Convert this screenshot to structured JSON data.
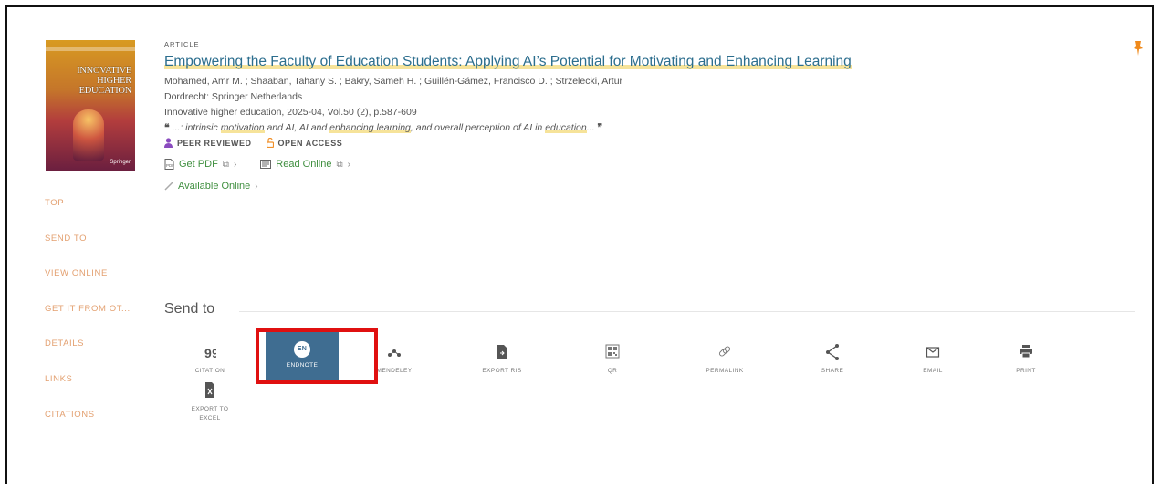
{
  "article": {
    "type": "ARTICLE",
    "title": "Empowering the Faculty of Education Students: Applying AI’s Potential for Motivating and Enhancing Learning",
    "authors": "Mohamed, Amr M. ; Shaaban, Tahany S. ; Bakry, Sameh H. ; Guillén-Gámez, Francisco D. ; Strzelecki, Artur",
    "publisher": "Dordrecht: Springer Netherlands",
    "source": "Innovative higher education, 2025-04, Vol.50 (2), p.587-609",
    "snippet": {
      "open_quote": "❝",
      "close_quote": "❞",
      "parts": [
        "...: intrinsic ",
        "motivation",
        " and AI, AI and ",
        "enhancing learning",
        ", and overall perception of AI in ",
        "education",
        "..."
      ]
    },
    "badges": {
      "peer_reviewed": "PEER REVIEWED",
      "open_access": "OPEN ACCESS"
    },
    "cover": {
      "title": "INNOVATIVE HIGHER EDUCATION",
      "publisher": "Springer"
    }
  },
  "links": {
    "get_pdf": "Get PDF",
    "read_online": "Read Online",
    "available_online": "Available Online"
  },
  "nav": {
    "items": [
      "TOP",
      "SEND TO",
      "VIEW ONLINE",
      "GET IT FROM OT...",
      "DETAILS",
      "LINKS",
      "CITATIONS"
    ]
  },
  "send_to": {
    "title": "Send to",
    "actions": [
      {
        "label": "CITATION",
        "icon": "quote-icon"
      },
      {
        "label": "ENDNOTE",
        "icon": "endnote-icon",
        "icon_text": "EN",
        "selected": true
      },
      {
        "label": "MENDELEY",
        "icon": "mendeley-icon"
      },
      {
        "label": "EXPORT RIS",
        "icon": "export-file-icon"
      },
      {
        "label": "QR",
        "icon": "qr-code-icon"
      },
      {
        "label": "PERMALINK",
        "icon": "link-icon"
      },
      {
        "label": "SHARE",
        "icon": "share-icon"
      },
      {
        "label": "EMAIL",
        "icon": "envelope-icon"
      },
      {
        "label": "PRINT",
        "icon": "printer-icon"
      },
      {
        "label": "EXPORT TO EXCEL",
        "icon": "excel-file-icon"
      }
    ]
  },
  "colors": {
    "title": "#2c6e8e",
    "link_green": "#3f8f3f",
    "nav_orange": "#e3a070",
    "selected_bg": "#3f6d91",
    "highlight_box": "#e01010",
    "pin": "#f08a1c"
  }
}
